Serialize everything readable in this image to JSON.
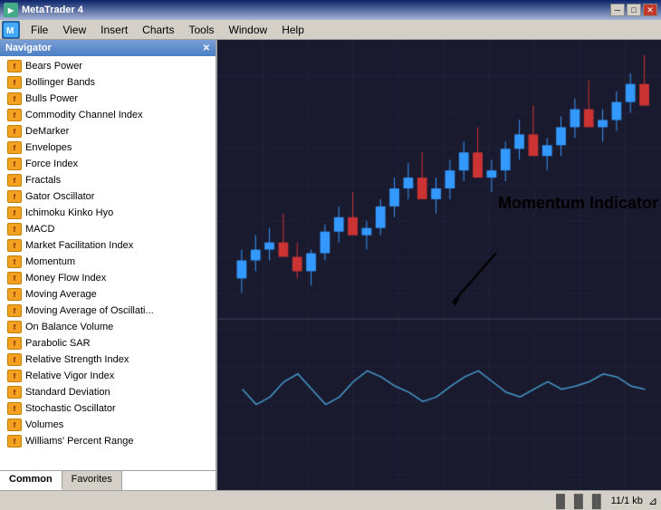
{
  "titlebar": {
    "title": "MetaTrader 4",
    "min_label": "─",
    "max_label": "□",
    "close_label": "✕"
  },
  "menubar": {
    "items": [
      {
        "label": "File",
        "id": "file"
      },
      {
        "label": "View",
        "id": "view"
      },
      {
        "label": "Insert",
        "id": "insert"
      },
      {
        "label": "Charts",
        "id": "charts"
      },
      {
        "label": "Tools",
        "id": "tools"
      },
      {
        "label": "Window",
        "id": "window"
      },
      {
        "label": "Help",
        "id": "help"
      }
    ]
  },
  "navigator": {
    "title": "Navigator",
    "items": [
      "Bears Power",
      "Bollinger Bands",
      "Bulls Power",
      "Commodity Channel Index",
      "DeMarker",
      "Envelopes",
      "Force Index",
      "Fractals",
      "Gator Oscillator",
      "Ichimoku Kinko Hyo",
      "MACD",
      "Market Facilitation Index",
      "Momentum",
      "Money Flow Index",
      "Moving Average",
      "Moving Average of Oscillati...",
      "On Balance Volume",
      "Parabolic SAR",
      "Relative Strength Index",
      "Relative Vigor Index",
      "Standard Deviation",
      "Stochastic Oscillator",
      "Volumes",
      "Williams' Percent Range"
    ],
    "tabs": [
      {
        "label": "Common",
        "active": true
      },
      {
        "label": "Favorites",
        "active": false
      }
    ]
  },
  "chart": {
    "momentum_label": "Momentum Indicator"
  },
  "statusbar": {
    "chart_info": "11/1 kb",
    "icon": "▐▌▐▌▐▌"
  },
  "mdi": {
    "min": "─",
    "max": "□",
    "close": "✕"
  }
}
